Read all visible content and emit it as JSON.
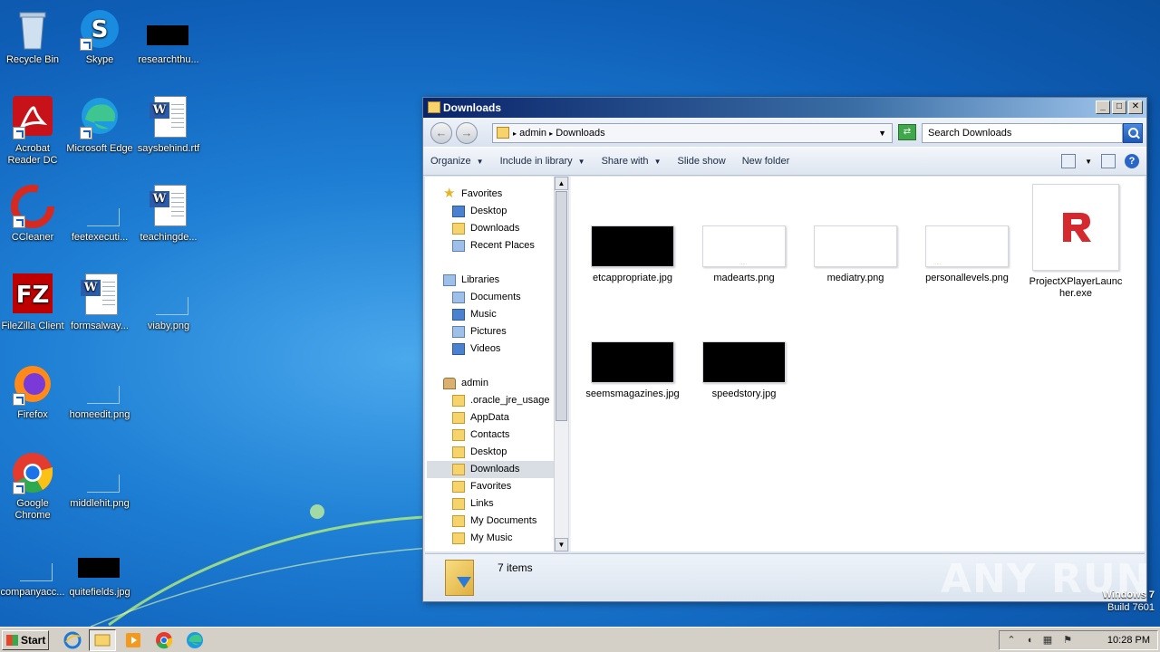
{
  "desktop": {
    "icons": [
      {
        "label": "Recycle Bin"
      },
      {
        "label": "Skype"
      },
      {
        "label": "researchthu..."
      },
      {
        "label": "Acrobat Reader DC"
      },
      {
        "label": "Microsoft Edge"
      },
      {
        "label": "saysbehind.rtf"
      },
      {
        "label": "CCleaner"
      },
      {
        "label": "feetexecuti..."
      },
      {
        "label": "teachingde..."
      },
      {
        "label": "FileZilla Client"
      },
      {
        "label": "formsalway..."
      },
      {
        "label": "viaby.png"
      },
      {
        "label": "Firefox"
      },
      {
        "label": "homeedit.png"
      },
      {
        "label": "Google Chrome"
      },
      {
        "label": "middlehit.png"
      },
      {
        "label": "companyacc..."
      },
      {
        "label": "quitefields.jpg"
      }
    ]
  },
  "window": {
    "title": "Downloads",
    "address": {
      "crumb1": "admin",
      "crumb2": "Downloads"
    },
    "search_placeholder": "Search Downloads",
    "toolbar": {
      "organize": "Organize",
      "include": "Include in library",
      "share": "Share with",
      "slideshow": "Slide show",
      "newfolder": "New folder"
    },
    "nav": [
      {
        "label": "Favorites"
      },
      {
        "label": "Desktop"
      },
      {
        "label": "Downloads"
      },
      {
        "label": "Recent Places"
      },
      {
        "label": "Libraries"
      },
      {
        "label": "Documents"
      },
      {
        "label": "Music"
      },
      {
        "label": "Pictures"
      },
      {
        "label": "Videos"
      },
      {
        "label": "admin"
      },
      {
        "label": ".oracle_jre_usage"
      },
      {
        "label": "AppData"
      },
      {
        "label": "Contacts"
      },
      {
        "label": "Desktop"
      },
      {
        "label": "Downloads"
      },
      {
        "label": "Favorites"
      },
      {
        "label": "Links"
      },
      {
        "label": "My Documents"
      },
      {
        "label": "My Music"
      }
    ],
    "files": [
      {
        "name": "etcappropriate.jpg"
      },
      {
        "name": "madearts.png"
      },
      {
        "name": "mediatry.png"
      },
      {
        "name": "personallevels.png"
      },
      {
        "name": "ProjectXPlayerLauncher.exe"
      },
      {
        "name": "seemsmagazines.jpg"
      },
      {
        "name": "speedstory.jpg"
      }
    ],
    "status": "7 items"
  },
  "watermark": "ANY RUN",
  "wininfo": {
    "line1": "Windows 7",
    "line2": "Build 7601"
  },
  "taskbar": {
    "start": "Start",
    "time": "10:28 PM"
  }
}
